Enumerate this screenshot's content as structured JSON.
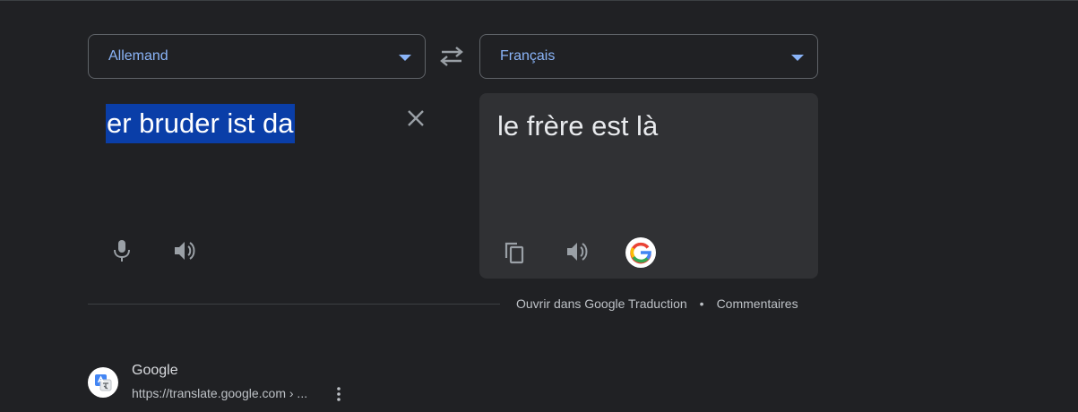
{
  "source_language": {
    "label": "Allemand"
  },
  "target_language": {
    "label": "Français"
  },
  "source": {
    "text": "er bruder ist da"
  },
  "output": {
    "text": "le frère est là"
  },
  "footer": {
    "open_link": "Ouvrir dans Google Traduction",
    "separator": "•",
    "feedback_link": "Commentaires"
  },
  "result": {
    "site_name": "Google",
    "url": "https://translate.google.com › ..."
  },
  "icons": {
    "swap": "swap-icon",
    "clear": "close-icon",
    "mic": "microphone-icon",
    "speaker": "speaker-icon",
    "copy": "copy-icon",
    "google": "google-logo",
    "favicon": "translate-favicon",
    "more": "more-vert-icon"
  },
  "colors": {
    "background": "#202124",
    "panel": "#303134",
    "accent": "#8ab4f8",
    "selection": "#0a3ea8"
  }
}
